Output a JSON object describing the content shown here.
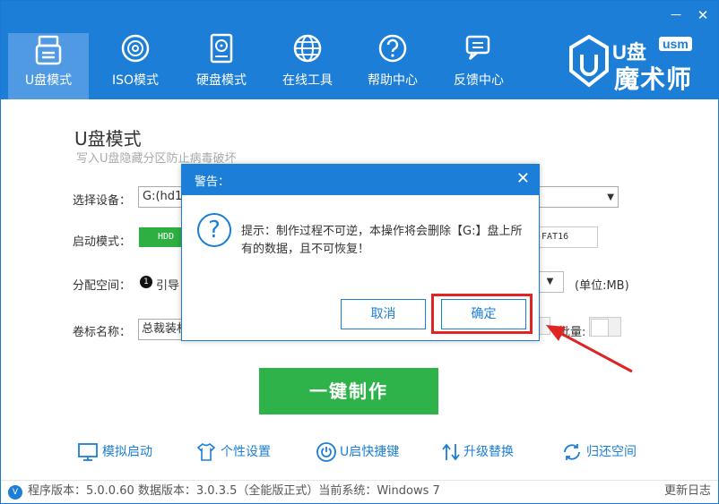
{
  "window": {
    "minimize_glyph": "－",
    "close_glyph": "✕"
  },
  "nav": [
    {
      "label": "U盘模式",
      "icon": "usb-drive-icon",
      "active": true
    },
    {
      "label": "ISO模式",
      "icon": "disc-icon",
      "active": false
    },
    {
      "label": "硬盘模式",
      "icon": "hard-disk-icon",
      "active": false
    },
    {
      "label": "在线工具",
      "icon": "globe-icon",
      "active": false
    },
    {
      "label": "帮助中心",
      "icon": "help-icon",
      "active": false
    },
    {
      "label": "反馈中心",
      "icon": "chat-icon",
      "active": false
    }
  ],
  "logo": {
    "top_text": "U盘",
    "badge": "usm",
    "name": "魔术师"
  },
  "main": {
    "title": "U盘模式",
    "subtitle": "写入U盘隐藏分区防止病毒破坏",
    "device_label": "选择设备：",
    "device_value": "G:(hd1)",
    "boot_label": "启动模式：",
    "boot_value": "HDD",
    "fs_value": "-FAT16",
    "alloc_label": "分配空间：",
    "alloc_number": "1",
    "alloc_text": "引导",
    "unit_label": "(单位:MB)",
    "volume_label": "卷标名称：",
    "volume_value": "总裁装机",
    "batch_label": "批量:",
    "make_button": "一键制作"
  },
  "tools": [
    {
      "label": "模拟启动",
      "icon": "monitor-icon"
    },
    {
      "label": "个性设置",
      "icon": "shirt-icon"
    },
    {
      "label": "U启快捷键",
      "icon": "power-icon"
    },
    {
      "label": "升级替换",
      "icon": "upgrade-icon"
    },
    {
      "label": "归还空间",
      "icon": "recycle-icon"
    }
  ],
  "status": {
    "icon_letter": "V",
    "text": "程序版本：5.0.0.60  数据版本：3.0.3.5（全能版正式）当前系统：Windows 7",
    "changelog": "更新日志"
  },
  "dialog": {
    "title": "警告：",
    "close_glyph": "✕",
    "icon_glyph": "?",
    "message": "提示：制作过程不可逆，本操作将会删除【G:】盘上所有的数据，且不可恢复！",
    "cancel_label": "取消",
    "ok_label": "确定"
  },
  "colors": {
    "brand": "#1c7ed6",
    "active_tab": "#4f9ae3",
    "primary_action": "#2eb24a",
    "highlight": "#e02424"
  }
}
